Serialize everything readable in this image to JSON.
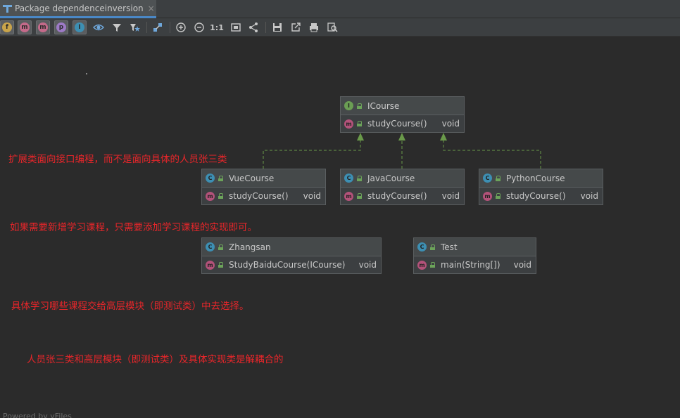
{
  "tab": {
    "title": "Package dependenceinversion",
    "close": "×"
  },
  "toolbar": {
    "buttons": [
      {
        "name": "show-fields-button",
        "icon": "field-icon",
        "glyph": "f",
        "color": "#c9a44a"
      },
      {
        "name": "show-constructors-button",
        "icon": "constructor-icon",
        "glyph": "m",
        "color": "#c46a8a"
      },
      {
        "name": "show-methods-button",
        "icon": "method-icon",
        "glyph": "m",
        "color": "#c46a8a"
      },
      {
        "name": "show-properties-button",
        "icon": "property-icon",
        "glyph": "p",
        "color": "#9d7ac6"
      },
      {
        "name": "show-inner-classes-button",
        "icon": "inner-class-icon",
        "glyph": "I",
        "color": "#3d8fb3"
      }
    ],
    "zoom_actual": "1:1"
  },
  "nodes": {
    "icourse": {
      "name": "ICourse",
      "kind": "I",
      "methods": [
        {
          "name": "studyCourse()",
          "type": "void"
        }
      ]
    },
    "vuecourse": {
      "name": "VueCourse",
      "kind": "C",
      "methods": [
        {
          "name": "studyCourse()",
          "type": "void"
        }
      ]
    },
    "javacourse": {
      "name": "JavaCourse",
      "kind": "C",
      "methods": [
        {
          "name": "studyCourse()",
          "type": "void"
        }
      ]
    },
    "pythoncourse": {
      "name": "PythonCourse",
      "kind": "C",
      "methods": [
        {
          "name": "studyCourse()",
          "type": "void"
        }
      ]
    },
    "zhangsan": {
      "name": "Zhangsan",
      "kind": "C",
      "methods": [
        {
          "name": "StudyBaiduCourse(ICourse)",
          "type": "void"
        }
      ]
    },
    "test": {
      "name": "Test",
      "kind": "C",
      "methods": [
        {
          "name": "main(String[])",
          "type": "void"
        }
      ]
    }
  },
  "method_icon": "m",
  "notes": [
    "扩展类面向接口编程，而不是面向具体的人员张三类",
    "如果需要新增学习课程，只需要添加学习课程的实现即可。",
    "具体学习哪些课程交给高层模块（即测试类）中去选择。",
    "人员张三类和高层模块（即测试类）及具体实现类是解耦合的"
  ],
  "footer": "Powered by yFiles",
  "colors": {
    "note": "#e8262a",
    "edge": "#6a9a4a",
    "class_icon": "#3d8fb3",
    "interface_icon": "#6b9e54",
    "method_icon": "#b3527a"
  }
}
